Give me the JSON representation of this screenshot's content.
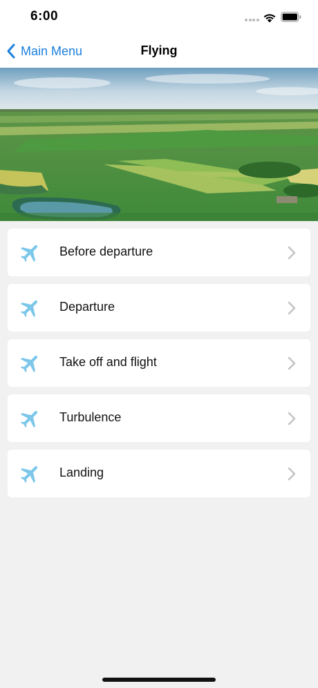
{
  "status_bar": {
    "time": "6:00"
  },
  "nav": {
    "back_label": "Main Menu",
    "title": "Flying"
  },
  "colors": {
    "accent": "#1a7fdc",
    "plane_icon": "#7cc7ea",
    "chevron": "#c4c4c6",
    "background": "#f1f1f1"
  },
  "menu": {
    "items": [
      {
        "label": "Before departure",
        "icon": "airplane-icon"
      },
      {
        "label": "Departure",
        "icon": "airplane-icon"
      },
      {
        "label": "Take off and flight",
        "icon": "airplane-icon"
      },
      {
        "label": "Turbulence",
        "icon": "airplane-icon"
      },
      {
        "label": "Landing",
        "icon": "airplane-icon"
      }
    ]
  }
}
